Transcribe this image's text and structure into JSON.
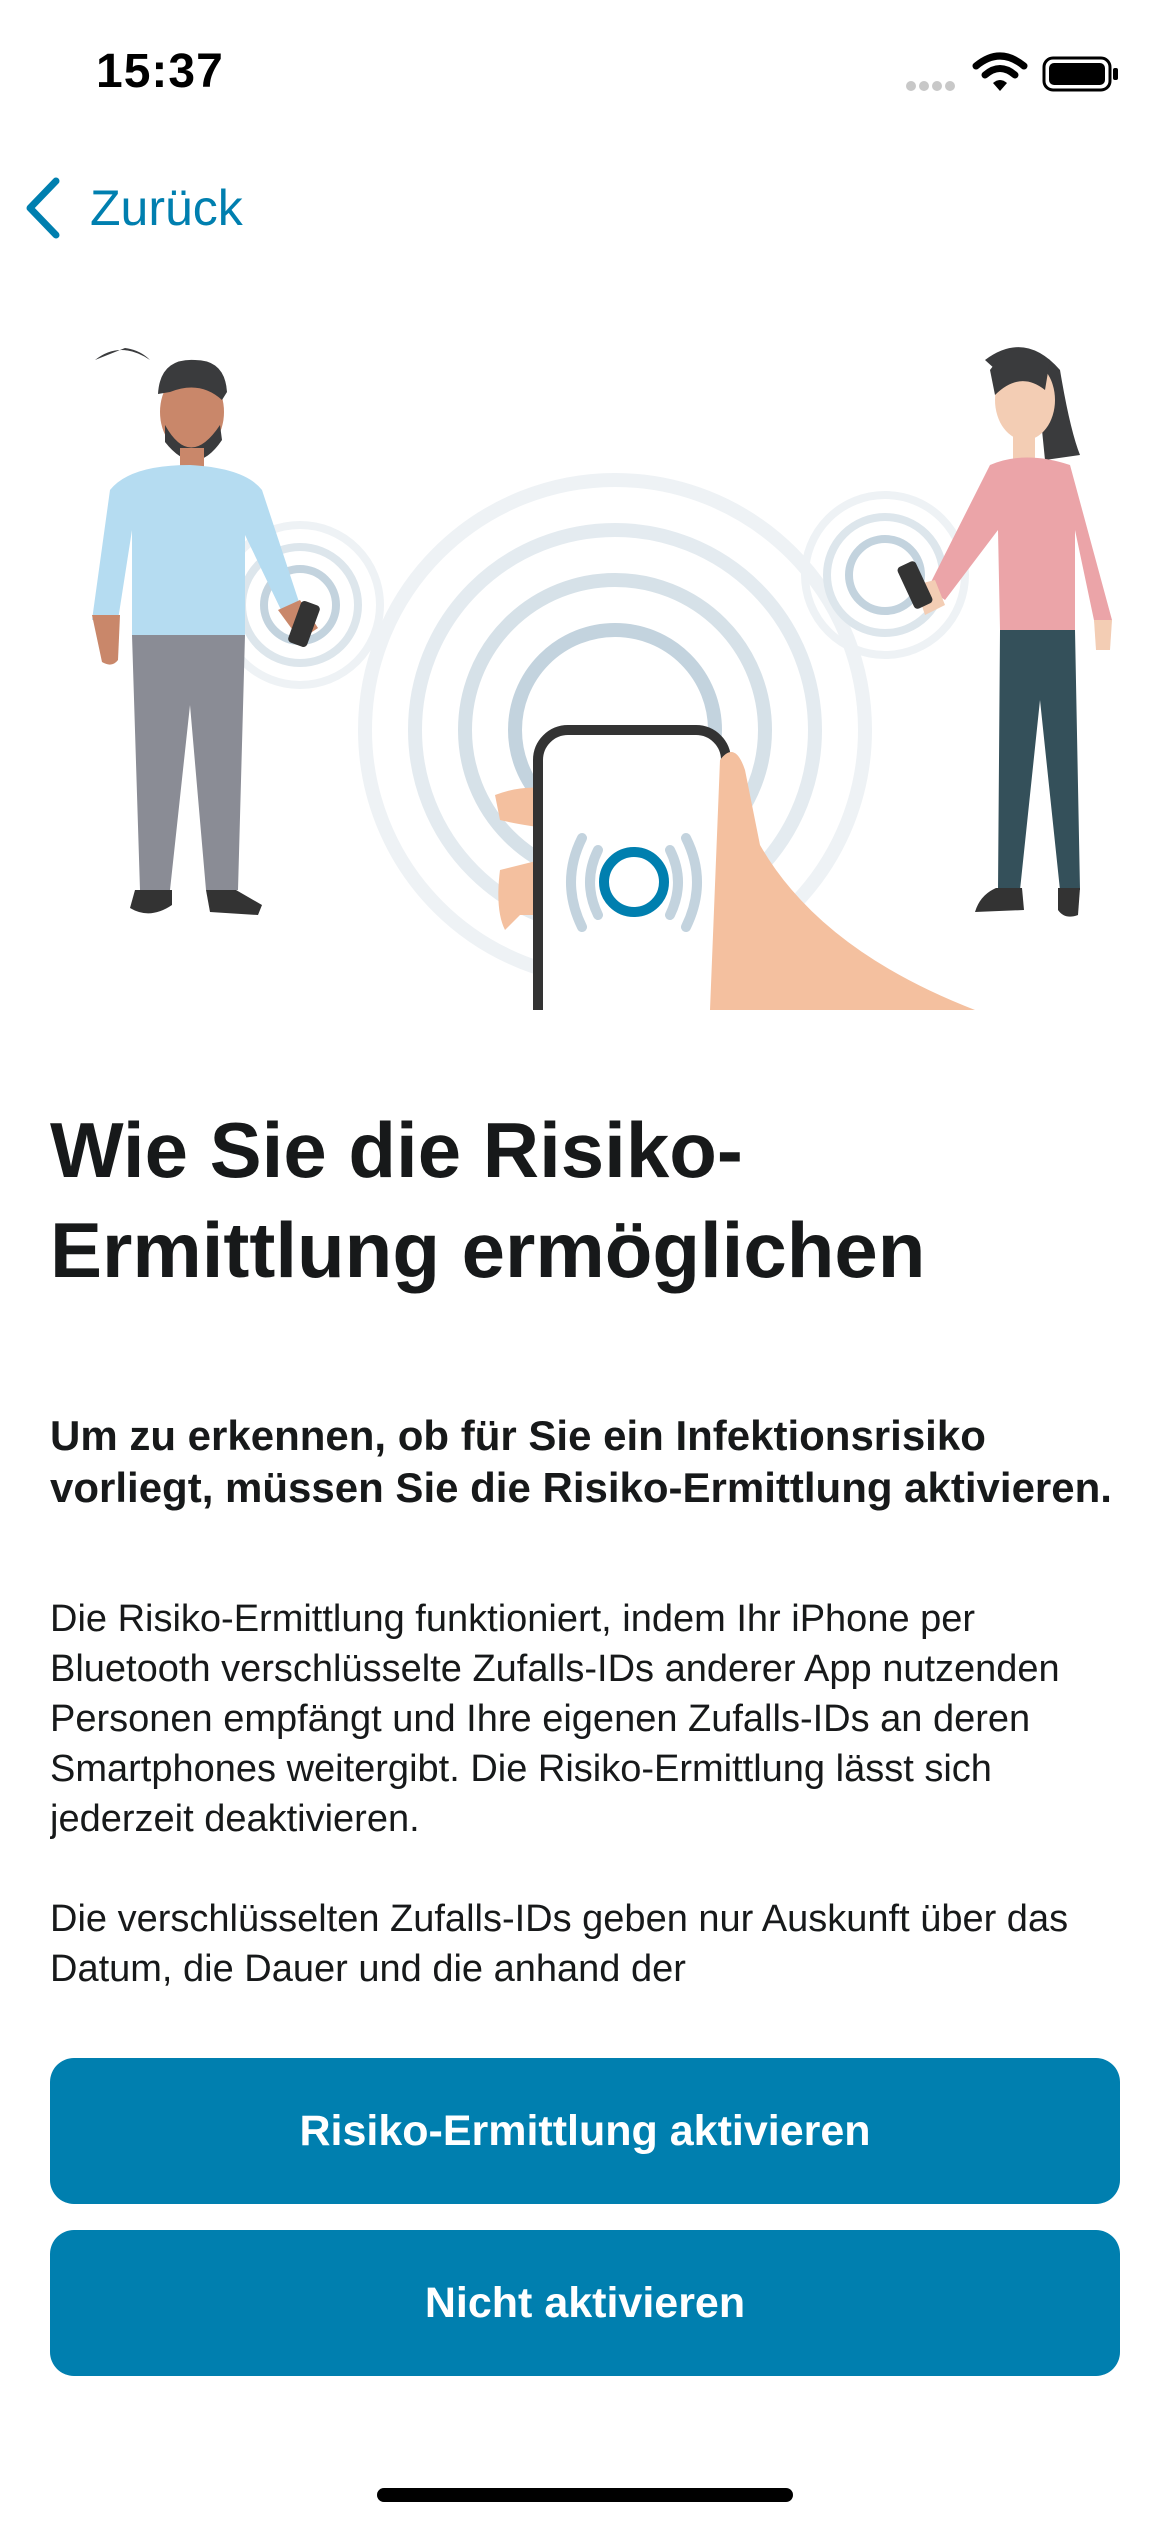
{
  "status_bar": {
    "time": "15:37",
    "icons": [
      "signal-dots-icon",
      "wifi-icon",
      "battery-icon"
    ]
  },
  "nav": {
    "back_label": "Zurück",
    "back_icon": "chevron-left-icon"
  },
  "colors": {
    "accent": "#007faf",
    "text": "#17191a",
    "background": "#ffffff"
  },
  "content": {
    "title": "Wie Sie die Risiko-Ermittlung ermöglichen",
    "lead": "Um zu erkennen, ob für Sie ein Infektionsrisiko vorliegt, müssen Sie die Risiko-Ermittlung aktivieren.",
    "paragraph_1": "Die Risiko-Ermittlung funktioniert, indem Ihr iPhone per Bluetooth verschlüsselte Zufalls-IDs anderer App nutzenden Personen empfängt und Ihre eigenen Zufalls-IDs an deren Smartphones weitergibt. Die Risiko-Ermittlung lässt sich jederzeit deaktivieren.",
    "paragraph_2": "Die verschlüsselten Zufalls-IDs geben nur Auskunft über das Datum, die Dauer und die anhand der"
  },
  "buttons": {
    "activate_label": "Risiko-Ermittlung aktivieren",
    "skip_label": "Nicht aktivieren"
  }
}
